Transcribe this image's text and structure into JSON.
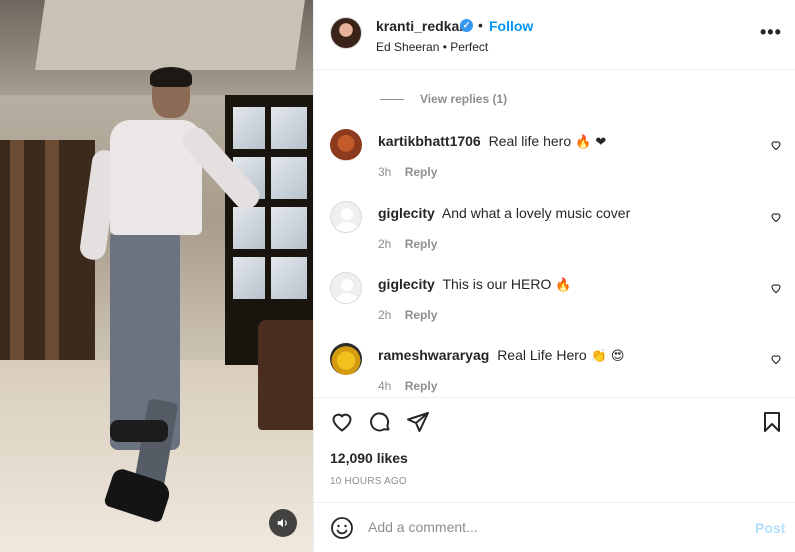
{
  "post": {
    "username": "kranti_redkar",
    "follow_label": "Follow",
    "separator": "•",
    "audio": "Ed Sheeran • Perfect",
    "more_label": "•••"
  },
  "thread": {
    "view_replies": "View replies (1)"
  },
  "comments": [
    {
      "username": "kartikbhatt1706",
      "text": "Real life hero",
      "emojis": "🔥 ❤",
      "time": "3h",
      "reply": "Reply"
    },
    {
      "username": "giglecity",
      "text": "And what a lovely music cover",
      "emojis": "",
      "time": "2h",
      "reply": "Reply"
    },
    {
      "username": "giglecity",
      "text": "This is our HERO",
      "emojis": "🔥",
      "time": "2h",
      "reply": "Reply"
    },
    {
      "username": "rameshwararyag",
      "text": "Real Life Hero",
      "emojis": "👏 😍",
      "time": "4h",
      "reply": "Reply"
    }
  ],
  "stats": {
    "likes": "12,090 likes",
    "time_ago": "10 HOURS AGO"
  },
  "composer": {
    "placeholder": "Add a comment...",
    "post_label": "Post"
  },
  "icons": {
    "header": [
      "verified-badge-icon",
      "more-options-icon"
    ],
    "actions": [
      "heart-icon",
      "comment-icon",
      "share-icon",
      "bookmark-icon"
    ],
    "media": [
      "speaker-icon"
    ],
    "composer": [
      "emoji-icon"
    ]
  },
  "colors": {
    "link_blue": "#0095f6",
    "verified_blue": "#3897f0",
    "muted": "#8e8e8e",
    "post_disabled": "#b2dffc"
  }
}
